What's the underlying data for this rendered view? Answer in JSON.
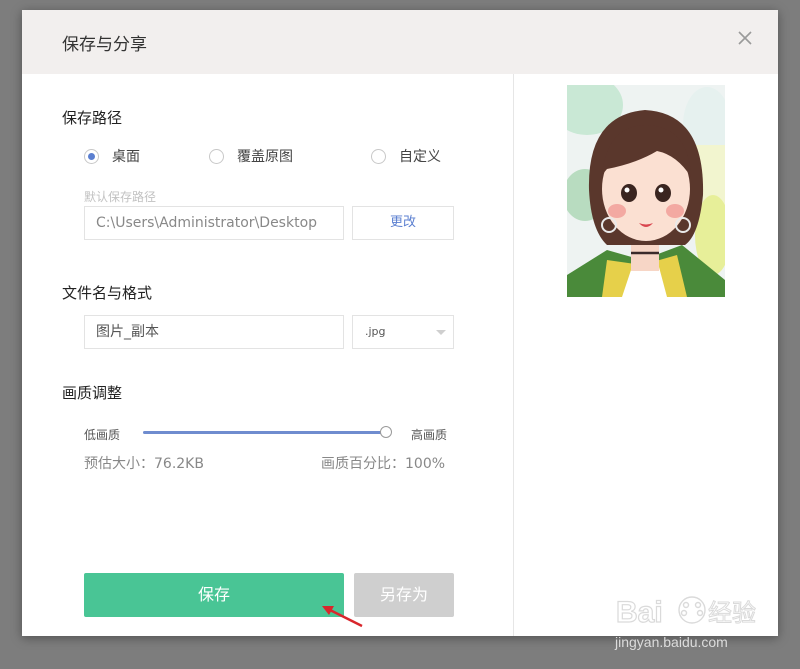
{
  "dialog": {
    "title": "保存与分享",
    "close_icon": "close-icon"
  },
  "save_path": {
    "label": "保存路径",
    "options": [
      {
        "label": "桌面",
        "checked": true
      },
      {
        "label": "覆盖原图",
        "checked": false
      },
      {
        "label": "自定义",
        "checked": false
      }
    ],
    "hint": "默认保存路径",
    "path_value": "C:\\Users\\Administrator\\Desktop",
    "change_button": "更改"
  },
  "filename": {
    "label": "文件名与格式",
    "value": "图片_副本",
    "format": ".jpg"
  },
  "quality": {
    "label": "画质调整",
    "low_label": "低画质",
    "high_label": "高画质",
    "slider_value_percent": 100,
    "size_estimate": "预估大小：76.2KB",
    "percent_text": "画质百分比：100%"
  },
  "actions": {
    "save": "保存",
    "save_as": "另存为"
  },
  "watermark": {
    "brand": "Bai",
    "brand_suffix": "经验",
    "url": "jingyan.baidu.com"
  },
  "colors": {
    "accent_green": "#49c595",
    "slider_blue": "#6f8ccf",
    "header_bg": "#f2efee"
  }
}
